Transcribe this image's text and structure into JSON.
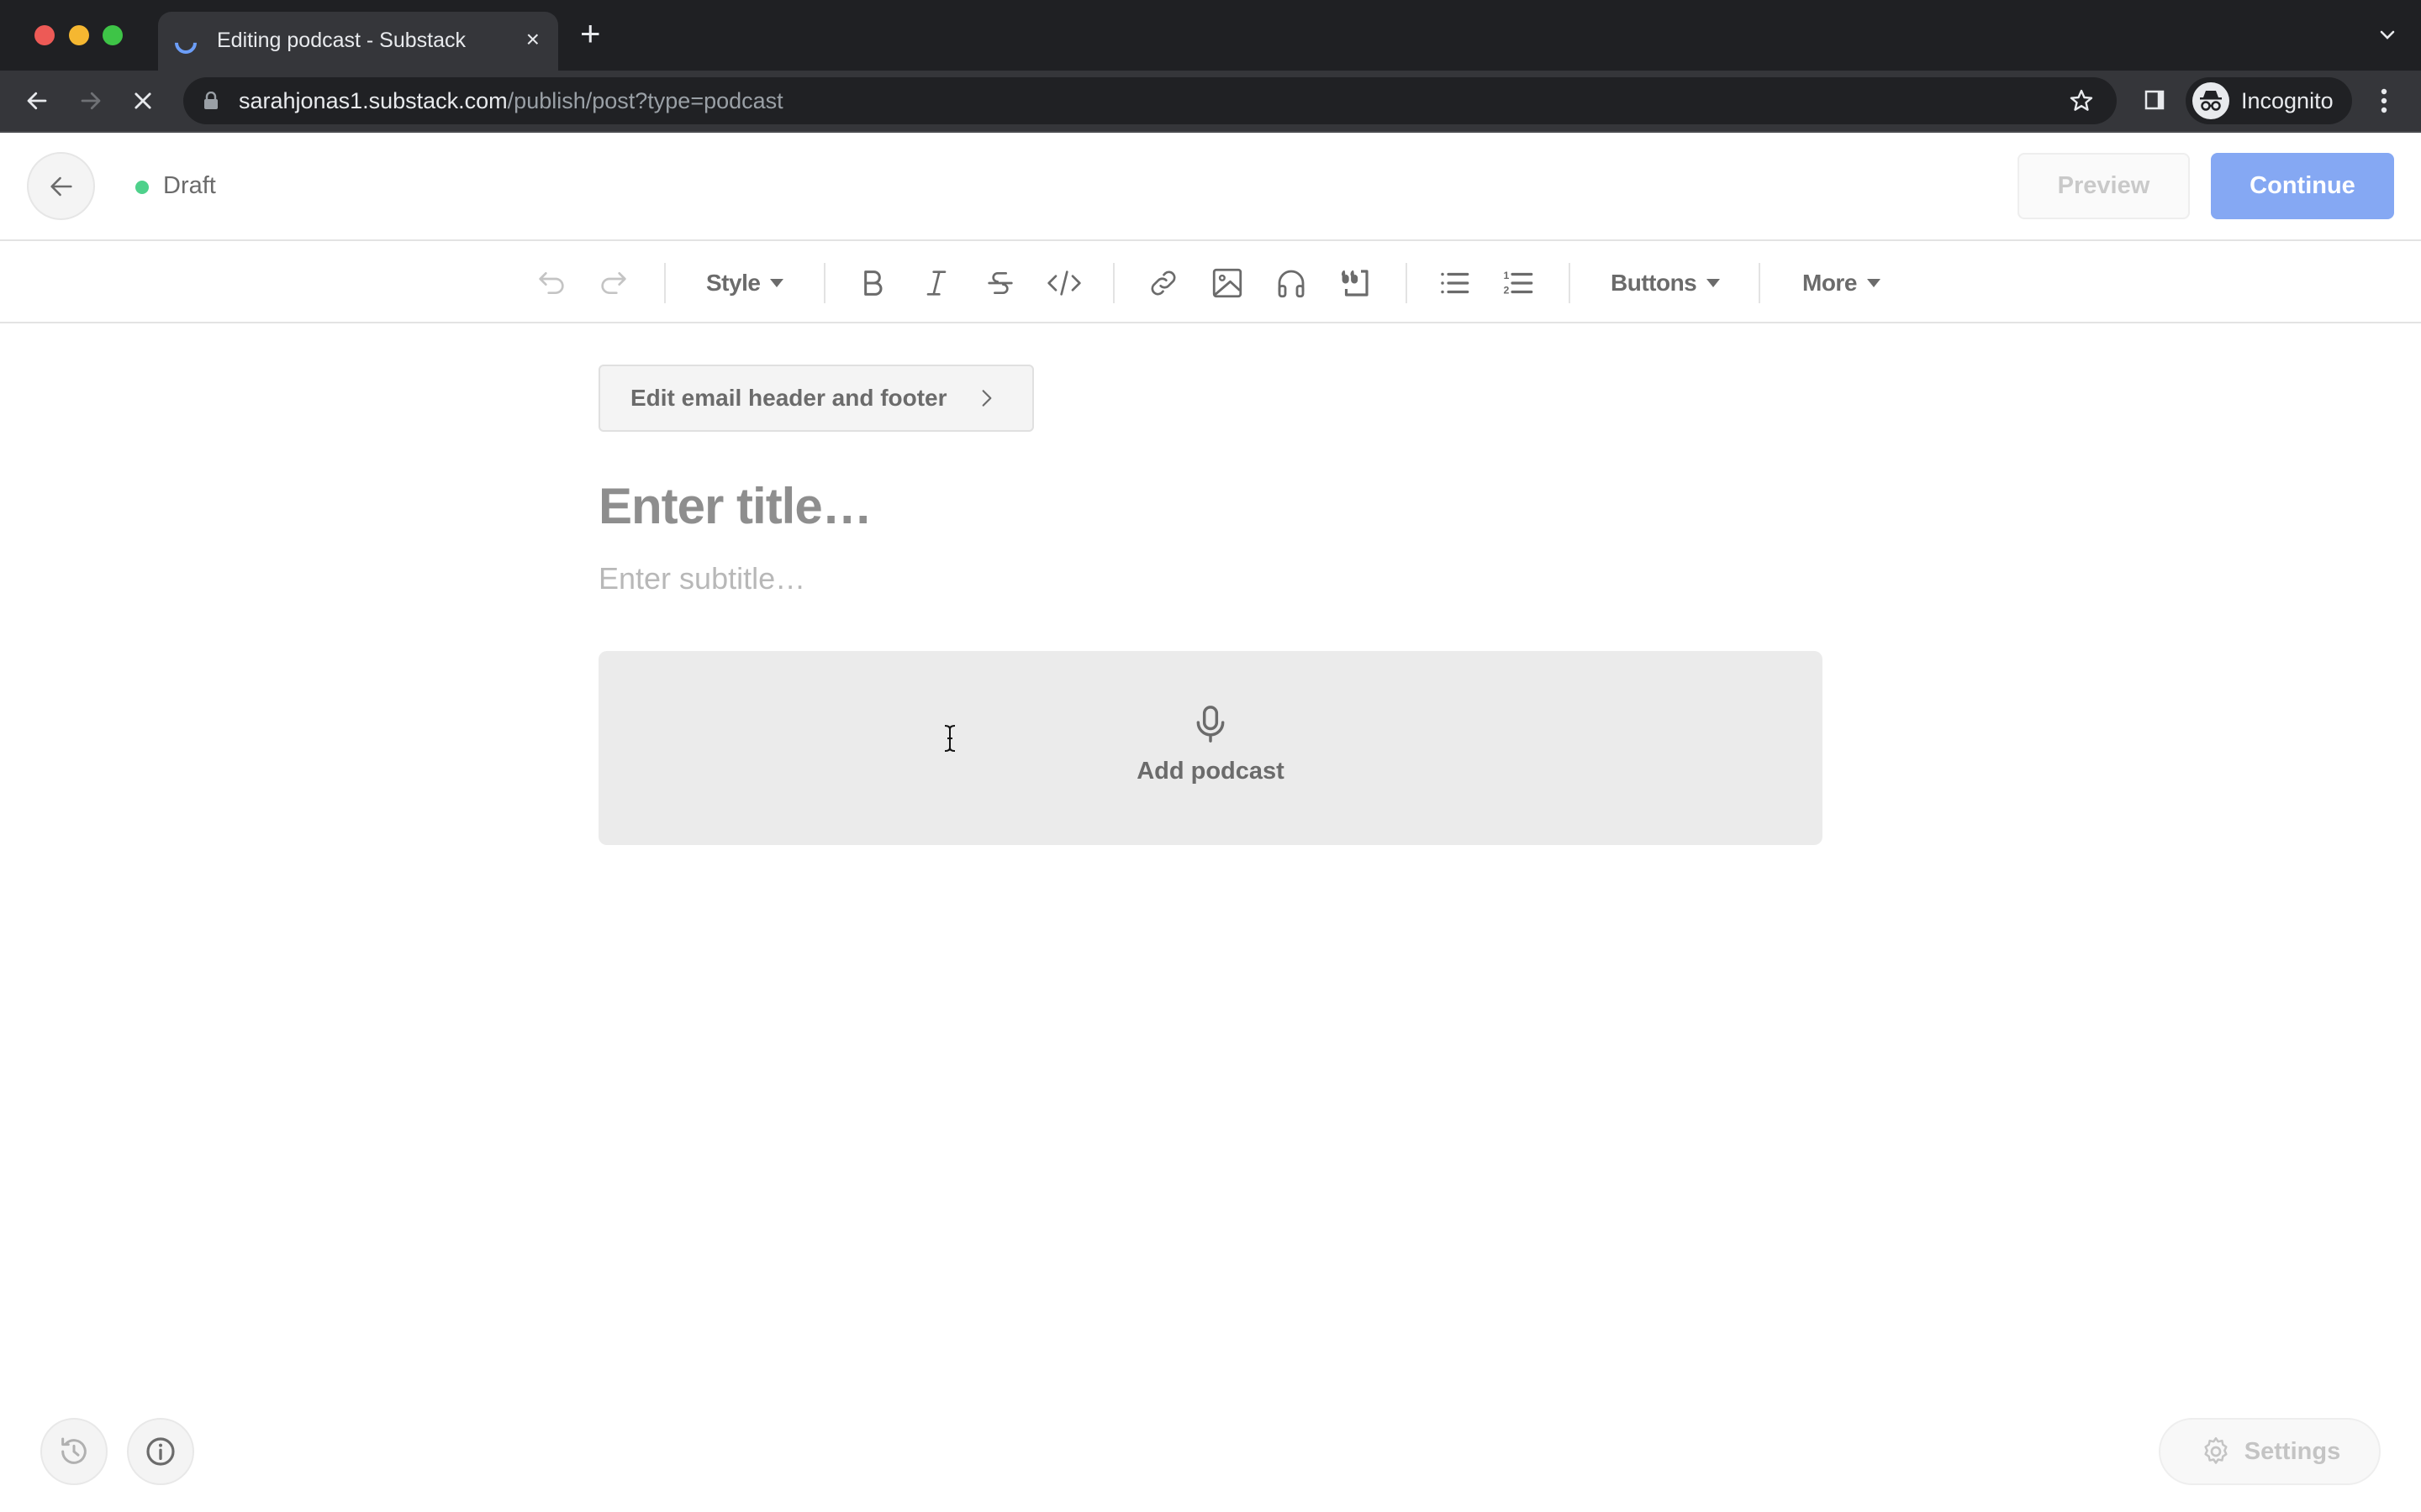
{
  "browser": {
    "tab": {
      "title": "Editing podcast - Substack",
      "close_glyph": "×"
    },
    "new_tab_glyph": "+",
    "url": {
      "host": "sarahjonas1.substack.com",
      "path": "/publish/post?type=podcast"
    },
    "profile_label": "Incognito",
    "icons": {
      "back": "arrow-left-icon",
      "forward": "arrow-right-icon",
      "stop": "close-icon",
      "lock": "lock-icon",
      "bookmark": "star-icon",
      "side_panel": "side-panel-icon",
      "incognito": "incognito-icon",
      "menu": "kebab-menu-icon",
      "tab_list": "chevron-down-icon"
    }
  },
  "header": {
    "status_label": "Draft",
    "status_color": "#4ed18b",
    "preview_label": "Preview",
    "continue_label": "Continue",
    "accent_color": "#85a8f3"
  },
  "editor_toolbar": {
    "style_label": "Style",
    "buttons_label": "Buttons",
    "more_label": "More",
    "tools": [
      "undo",
      "redo",
      "bold",
      "italic",
      "strikethrough",
      "code",
      "link",
      "image",
      "audio",
      "pull-quote",
      "bulleted-list",
      "numbered-list"
    ]
  },
  "editor": {
    "email_header_footer_label": "Edit email header and footer",
    "title_placeholder": "Enter title…",
    "subtitle_placeholder": "Enter subtitle…",
    "add_podcast_label": "Add podcast"
  },
  "footer": {
    "settings_label": "Settings"
  }
}
